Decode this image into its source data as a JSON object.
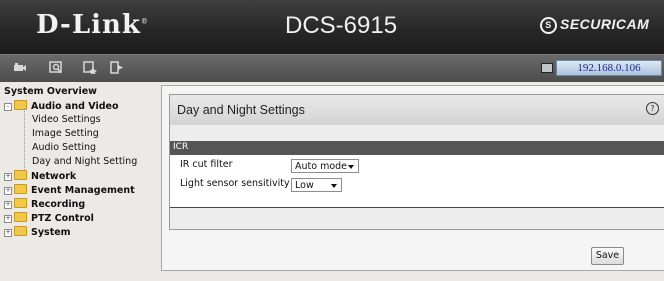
{
  "header": {
    "brand": "D-Link",
    "brand_mark": "®",
    "model": "DCS-6915",
    "partner_logo": "SECURICAM",
    "partner_logo_letter": "S"
  },
  "toolbar": {
    "icons": [
      "live-video-icon",
      "setup-icon",
      "maintenance-icon",
      "logout-icon"
    ],
    "ip_address": "192.168.0.106"
  },
  "sidebar": {
    "overview": "System Overview",
    "groups": [
      {
        "label": "Audio and Video",
        "expanded": true,
        "items": [
          "Video Settings",
          "Image Setting",
          "Audio Setting",
          "Day and Night Setting"
        ]
      },
      {
        "label": "Network",
        "expanded": false
      },
      {
        "label": "Event Management",
        "expanded": false
      },
      {
        "label": "Recording",
        "expanded": false
      },
      {
        "label": "PTZ Control",
        "expanded": false
      },
      {
        "label": "System",
        "expanded": false
      }
    ],
    "expander_minus": "-",
    "expander_plus": "+"
  },
  "main": {
    "panel_title": "Day and Night Settings",
    "help_icon": "?",
    "section_title": "ICR",
    "fields": [
      {
        "label": "IR cut filter",
        "value": "Auto mode"
      },
      {
        "label": "Light sensor sensitivity",
        "value": "Low"
      }
    ],
    "save_label": "Save"
  }
}
